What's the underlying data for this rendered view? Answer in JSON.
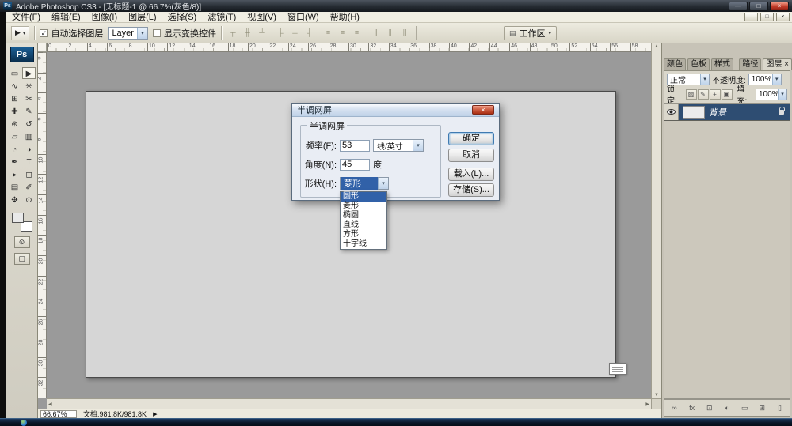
{
  "titlebar": {
    "app_icon": "Ps",
    "title": "Adobe Photoshop CS3 - [无标题-1 @ 66.7%(灰色/8)]",
    "minimize": "—",
    "maximize": "□",
    "close": "×"
  },
  "menubar": {
    "items": [
      {
        "name": "file",
        "label": "文件(F)"
      },
      {
        "name": "edit",
        "label": "编辑(E)"
      },
      {
        "name": "image",
        "label": "图像(I)"
      },
      {
        "name": "layer",
        "label": "图层(L)"
      },
      {
        "name": "select",
        "label": "选择(S)"
      },
      {
        "name": "filter",
        "label": "滤镜(T)"
      },
      {
        "name": "view",
        "label": "视图(V)"
      },
      {
        "name": "window",
        "label": "窗口(W)"
      },
      {
        "name": "help",
        "label": "帮助(H)"
      }
    ],
    "doc_minimize": "—",
    "doc_restore": "□",
    "doc_close": "×"
  },
  "options_bar": {
    "tool_icon": "▶",
    "tool_arrow": "▾",
    "auto_select_checked": "✓",
    "auto_select_label": "自动选择图层",
    "layer_combo_value": "Layer",
    "show_transform_label": "显示变换控件",
    "align_icons": [
      {
        "name": "align-top-edges-icon",
        "glyph": "╥"
      },
      {
        "name": "align-vertical-centers-icon",
        "glyph": "╫"
      },
      {
        "name": "align-bottom-edges-icon",
        "glyph": "╨"
      },
      {
        "name": "align-left-edges-icon",
        "glyph": "╞"
      },
      {
        "name": "align-horizontal-centers-icon",
        "glyph": "╪"
      },
      {
        "name": "align-right-edges-icon",
        "glyph": "╡"
      },
      {
        "name": "distribute-top-edges-icon",
        "glyph": "≡"
      },
      {
        "name": "distribute-vertical-centers-icon",
        "glyph": "≡"
      },
      {
        "name": "distribute-bottom-edges-icon",
        "glyph": "≡"
      },
      {
        "name": "distribute-left-edges-icon",
        "glyph": "∥"
      },
      {
        "name": "distribute-horizontal-centers-icon",
        "glyph": "∥"
      },
      {
        "name": "distribute-right-edges-icon",
        "glyph": "∥"
      }
    ],
    "workspace_icon": "▤",
    "workspace_label": "工作区",
    "workspace_arrow": "▾"
  },
  "toolbox": {
    "logo": "Ps",
    "tools": [
      {
        "name": "rectangular-marquee-tool",
        "glyph": "▭"
      },
      {
        "name": "move-tool",
        "glyph": "▶",
        "active": true
      },
      {
        "name": "lasso-tool",
        "glyph": "∿"
      },
      {
        "name": "magic-wand-tool",
        "glyph": "✳"
      },
      {
        "name": "crop-tool",
        "glyph": "⊞"
      },
      {
        "name": "slice-tool",
        "glyph": "✂"
      },
      {
        "name": "healing-brush-tool",
        "glyph": "✚"
      },
      {
        "name": "brush-tool",
        "glyph": "✎"
      },
      {
        "name": "clone-stamp-tool",
        "glyph": "⊛"
      },
      {
        "name": "history-brush-tool",
        "glyph": "↺"
      },
      {
        "name": "eraser-tool",
        "glyph": "▱"
      },
      {
        "name": "gradient-tool",
        "glyph": "▥"
      },
      {
        "name": "blur-tool",
        "glyph": "◔"
      },
      {
        "name": "dodge-tool",
        "glyph": "◑"
      },
      {
        "name": "pen-tool",
        "glyph": "✒"
      },
      {
        "name": "type-tool",
        "glyph": "T"
      },
      {
        "name": "path-selection-tool",
        "glyph": "▸"
      },
      {
        "name": "shape-tool",
        "glyph": "◻"
      },
      {
        "name": "notes-tool",
        "glyph": "▤"
      },
      {
        "name": "eyedropper-tool",
        "glyph": "✐"
      },
      {
        "name": "hand-tool",
        "glyph": "✥"
      },
      {
        "name": "zoom-tool",
        "glyph": "⊙"
      }
    ],
    "foreground_color": "#e9e9e9",
    "background_color": "#ffffff",
    "quick_mask_glyph": "⊙",
    "screen_mode_glyph": "▢"
  },
  "rulers": {
    "h_labels": [
      "0",
      "2",
      "4",
      "6",
      "8",
      "10",
      "12",
      "14",
      "16",
      "18",
      "20",
      "22",
      "24",
      "26",
      "28",
      "30",
      "32",
      "34",
      "36",
      "38",
      "40",
      "42",
      "44",
      "46",
      "48",
      "50",
      "52",
      "54",
      "56",
      "58"
    ],
    "v_labels": [
      "0",
      "2",
      "4",
      "6",
      "8",
      "10",
      "12",
      "14",
      "16",
      "18",
      "20",
      "22",
      "24",
      "26",
      "28",
      "30",
      "32"
    ]
  },
  "dialog": {
    "title": "半调网屏",
    "close": "×",
    "group_title": "半调网屏",
    "frequency": {
      "label": "频率(F):",
      "value": "53",
      "unit": "线/英寸",
      "unit_arrow": "▾"
    },
    "angle": {
      "label": "角度(N):",
      "value": "45",
      "unit": "度"
    },
    "shape": {
      "label": "形状(H):",
      "value": "菱形",
      "arrow": "▾"
    },
    "buttons": {
      "ok": "确定",
      "cancel": "取消",
      "load": "载入(L)...",
      "save": "存储(S)..."
    },
    "shape_options": [
      {
        "name": "circle",
        "label": "圆形"
      },
      {
        "name": "diamond",
        "label": "菱形"
      },
      {
        "name": "ellipse",
        "label": "椭圆"
      },
      {
        "name": "line",
        "label": "直线"
      },
      {
        "name": "square",
        "label": "方形"
      },
      {
        "name": "cross",
        "label": "十字线"
      }
    ],
    "highlighted_option_index": 0
  },
  "panels": {
    "tab_groups": [
      {
        "tabs": [
          {
            "name": "color",
            "label": "颜色"
          },
          {
            "name": "swatches",
            "label": "色板"
          },
          {
            "name": "styles",
            "label": "样式"
          }
        ]
      },
      {
        "tabs": [
          {
            "name": "paths",
            "label": "路径"
          },
          {
            "name": "layers",
            "label": "图层",
            "active": true,
            "close": "×"
          }
        ]
      }
    ],
    "layers": {
      "blend_mode": "正常",
      "blend_arrow": "▾",
      "opacity_label": "不透明度:",
      "opacity_value": "100%",
      "lock_label": "锁定:",
      "lock_icons": [
        {
          "name": "lock-transparent-pixels-icon",
          "glyph": "▨"
        },
        {
          "name": "lock-image-pixels-icon",
          "glyph": "✎"
        },
        {
          "name": "lock-position-icon",
          "glyph": "+"
        },
        {
          "name": "lock-all-icon",
          "glyph": "▣"
        }
      ],
      "fill_label": "填充:",
      "fill_value": "100%",
      "rows": [
        {
          "name": "背景",
          "visible": true,
          "locked": true
        }
      ],
      "bottom_icons": [
        {
          "name": "link-layers-icon",
          "glyph": "∞"
        },
        {
          "name": "layer-style-icon",
          "glyph": "fx"
        },
        {
          "name": "add-layer-mask-icon",
          "glyph": "⊡"
        },
        {
          "name": "new-adjustment-layer-icon",
          "glyph": "◐"
        },
        {
          "name": "new-group-icon",
          "glyph": "▭"
        },
        {
          "name": "new-layer-icon",
          "glyph": "⊞"
        },
        {
          "name": "delete-layer-icon",
          "glyph": "▯"
        }
      ]
    }
  },
  "status_bar": {
    "zoom": "66.67%",
    "doc_info": "文档:981.8K/981.8K",
    "expander": "▶"
  }
}
